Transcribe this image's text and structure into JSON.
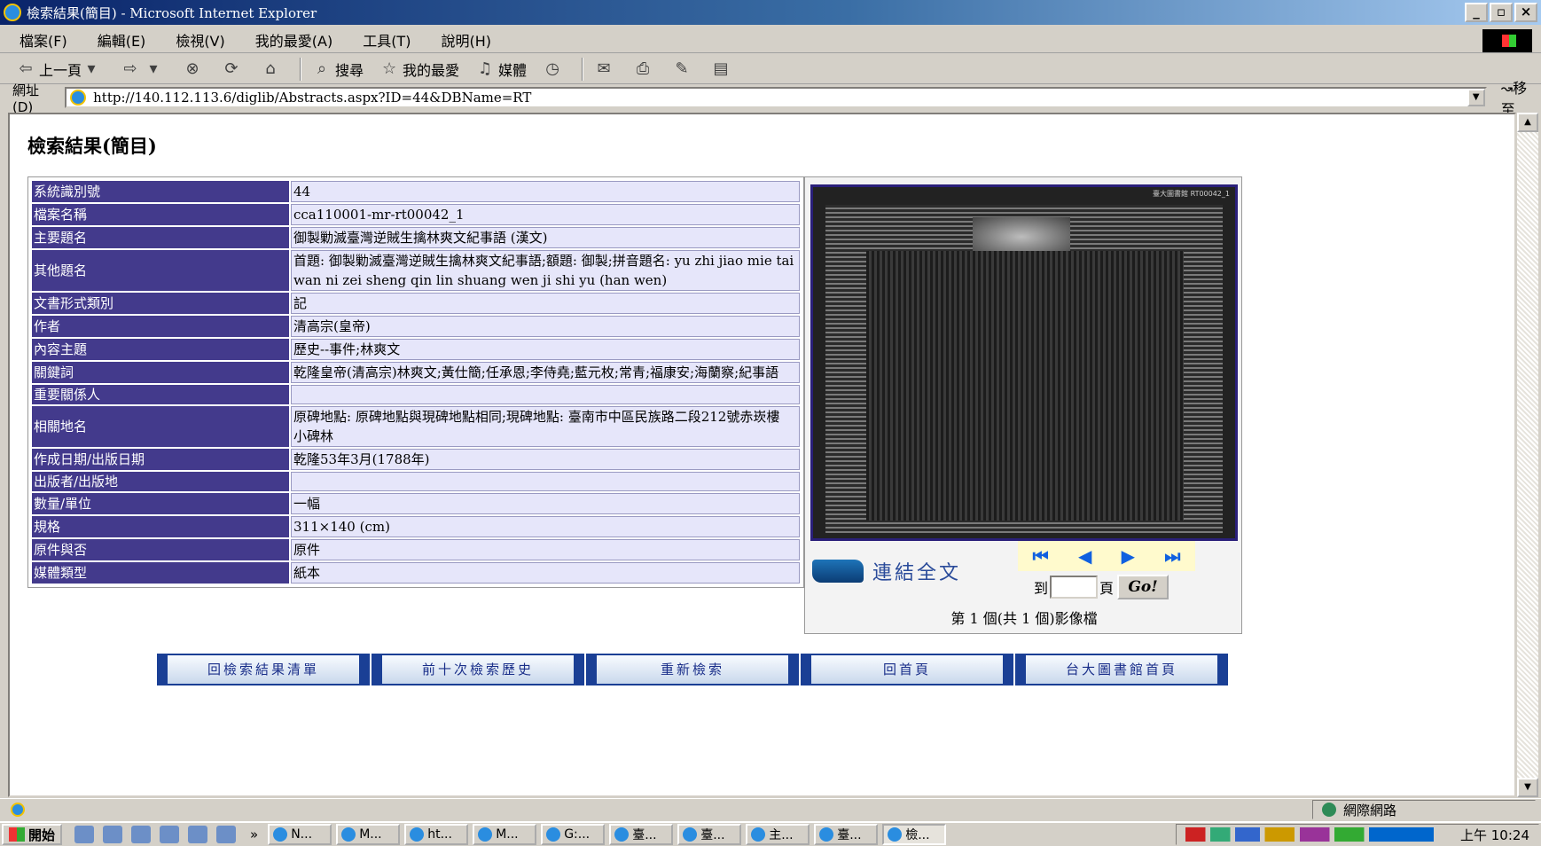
{
  "window": {
    "title": "檢索結果(簡目) - Microsoft Internet Explorer",
    "buttons": [
      "_",
      "▫",
      "×"
    ]
  },
  "menubar": [
    "檔案(F)",
    "編輯(E)",
    "檢視(V)",
    "我的最愛(A)",
    "工具(T)",
    "說明(H)"
  ],
  "toolbar": {
    "back": "上一頁",
    "search": "搜尋",
    "favorites": "我的最愛",
    "media": "媒體"
  },
  "address": {
    "label": "網址(D)",
    "url": "http://140.112.113.6/diglib/Abstracts.aspx?ID=44&DBName=RT",
    "go": "移至"
  },
  "page": {
    "title": "檢索結果(簡目)",
    "rows": [
      {
        "label": "系統識別號",
        "value": "44"
      },
      {
        "label": "檔案名稱",
        "value": "cca110001-mr-rt00042_1"
      },
      {
        "label": "主要題名",
        "value": "御製勦滅臺灣逆賊生擒林爽文紀事語 (漢文)"
      },
      {
        "label": "其他題名",
        "value": "首題: 御製勦滅臺灣逆賊生擒林爽文紀事語;額題: 御製;拼音題名: yu zhi jiao mie tai wan ni zei sheng qin lin shuang wen ji shi yu (han wen)"
      },
      {
        "label": "文書形式類別",
        "value": "記"
      },
      {
        "label": "作者",
        "value": "清高宗(皇帝)"
      },
      {
        "label": "內容主題",
        "value": "歷史--事件;林爽文"
      },
      {
        "label": "關鍵詞",
        "value": "乾隆皇帝(清高宗)林爽文;黃仕簡;任承恩;李侍堯;藍元枚;常青;福康安;海蘭察;紀事語"
      },
      {
        "label": "重要關係人",
        "value": ""
      },
      {
        "label": "相關地名",
        "value": "原碑地點: 原碑地點與現碑地點相同;現碑地點: 臺南市中區民族路二段212號赤崁樓 小碑林"
      },
      {
        "label": "作成日期/出版日期",
        "value": "乾隆53年3月(1788年)"
      },
      {
        "label": "出版者/出版地",
        "value": ""
      },
      {
        "label": "數量/單位",
        "value": "一幅"
      },
      {
        "label": "規格",
        "value": "311×140 (cm)"
      },
      {
        "label": "原件與否",
        "value": "原件"
      },
      {
        "label": "媒體類型",
        "value": "紙本"
      }
    ],
    "image_caption": "臺大圖書館 RT00042_1",
    "link_full": "連結全文",
    "goto_prefix": "到",
    "goto_suffix": "頁",
    "go_button": "Go!",
    "image_count": "第 1 個(共 1 個)影像檔",
    "nav_buttons": [
      "回檢索結果清單",
      "前十次檢索歷史",
      "重新檢索",
      "回首頁",
      "台大圖書館首頁"
    ]
  },
  "statusbar": {
    "zone": "網際網路"
  },
  "taskbar": {
    "start": "開始",
    "more": "»",
    "tasks": [
      "N...",
      "M...",
      "ht...",
      "M...",
      "G:...",
      "臺...",
      "臺...",
      "主...",
      "臺...",
      "檢..."
    ],
    "clock": "上午 10:24"
  }
}
